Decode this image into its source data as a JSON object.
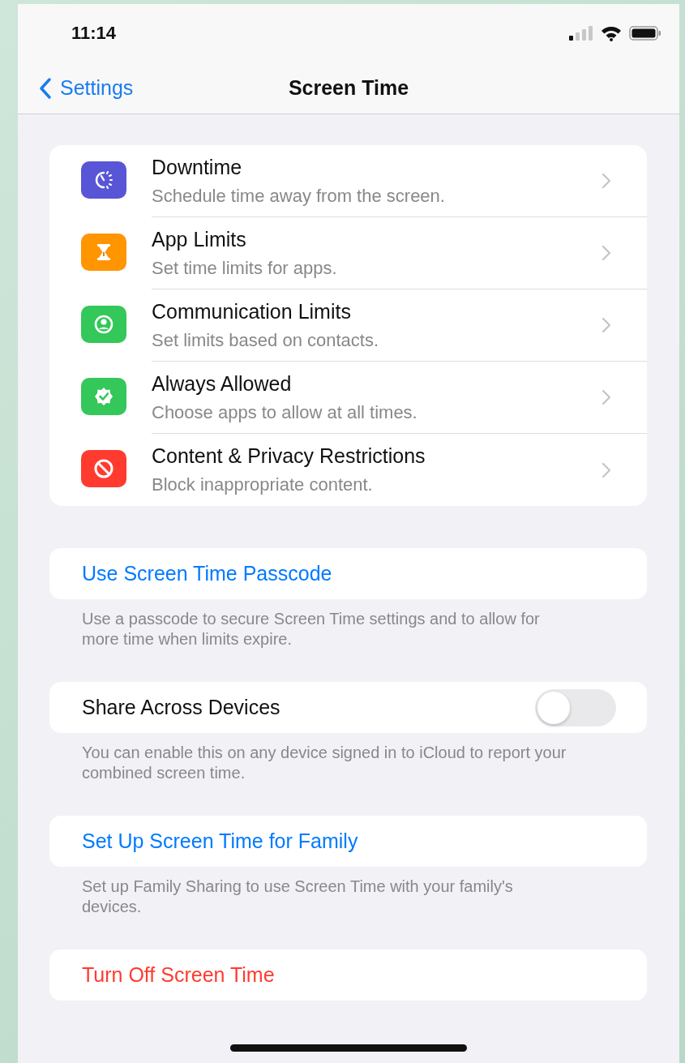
{
  "status_bar": {
    "time": "11:14"
  },
  "nav": {
    "back": "Settings",
    "title": "Screen Time"
  },
  "features": [
    {
      "kind": "moon-clock",
      "color": "#5856d6",
      "title": "Downtime",
      "subtitle": "Schedule time away from the screen."
    },
    {
      "kind": "hourglass",
      "color": "#ff9500",
      "title": "App Limits",
      "subtitle": "Set time limits for apps."
    },
    {
      "kind": "person",
      "color": "#34c759",
      "title": "Communication Limits",
      "subtitle": "Set limits based on contacts."
    },
    {
      "kind": "check-badge",
      "color": "#34c759",
      "title": "Always Allowed",
      "subtitle": "Choose apps to allow at all times."
    },
    {
      "kind": "no-entry",
      "color": "#ff3b30",
      "title": "Content & Privacy Restrictions",
      "subtitle": "Block inappropriate content."
    }
  ],
  "groups": [
    {
      "kind": "action",
      "label": "Use Screen Time Passcode",
      "color": "#007aff",
      "footer": "Use a passcode to secure Screen Time settings and to allow for more time when limits expire."
    },
    {
      "kind": "toggle",
      "label": "Share Across Devices",
      "on": false,
      "footer": "You can enable this on any device signed in to iCloud to report your combined screen time."
    },
    {
      "kind": "action",
      "label": "Set Up Screen Time for Family",
      "color": "#007aff",
      "footer": "Set up Family Sharing to use Screen Time with your family's devices."
    },
    {
      "kind": "action",
      "label": "Turn Off Screen Time",
      "color": "#ff3b30"
    }
  ]
}
